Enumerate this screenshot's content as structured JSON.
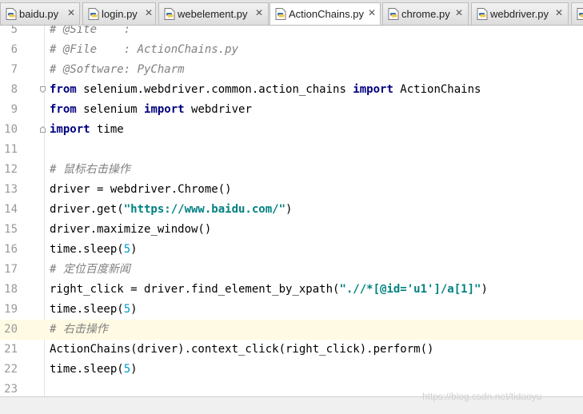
{
  "tabs": [
    {
      "label": "baidu.py"
    },
    {
      "label": "login.py"
    },
    {
      "label": "webelement.py"
    },
    {
      "label": "ActionChains.py",
      "active": true
    },
    {
      "label": "chrome.py"
    },
    {
      "label": "webdriver.py"
    }
  ],
  "editor": {
    "current_line": "20",
    "lines": [
      {
        "no": "5"
      },
      {
        "no": "6"
      },
      {
        "no": "7"
      },
      {
        "no": "8"
      },
      {
        "no": "9"
      },
      {
        "no": "10"
      },
      {
        "no": "11"
      },
      {
        "no": "12"
      },
      {
        "no": "13"
      },
      {
        "no": "14"
      },
      {
        "no": "15"
      },
      {
        "no": "16"
      },
      {
        "no": "17"
      },
      {
        "no": "18"
      },
      {
        "no": "19"
      },
      {
        "no": "20"
      },
      {
        "no": "21"
      },
      {
        "no": "22"
      },
      {
        "no": "23"
      }
    ],
    "code": {
      "l5": "# @Site    :",
      "l6": "# @File    : ActionChains.py",
      "l7": "# @Software: PyCharm",
      "l8_kw1": "from",
      "l8_mod": " selenium.webdriver.common.action_chains ",
      "l8_kw2": "import",
      "l8_name": " ActionChains",
      "l9_kw1": "from",
      "l9_mod": " selenium ",
      "l9_kw2": "import",
      "l9_name": " webdriver",
      "l10_kw": "import",
      "l10_name": " time",
      "l12": "# 鼠标右击操作",
      "l13": "driver = webdriver.Chrome()",
      "l14_a": "driver.get(",
      "l14_str": "\"https://www.baidu.com/\"",
      "l14_b": ")",
      "l15": "driver.maximize_window()",
      "l16_a": "time.sleep(",
      "l16_num": "5",
      "l16_b": ")",
      "l17": "# 定位百度新闻",
      "l18_a": "right_click = driver.find_element_by_xpath(",
      "l18_str": "\".//*[@id='u1']/a[1]\"",
      "l18_b": ")",
      "l19_a": "time.sleep(",
      "l19_num": "5",
      "l19_b": ")",
      "l20": "# 右击操作",
      "l21": "ActionChains(driver).context_click(right_click).perform()",
      "l22_a": "time.sleep(",
      "l22_num": "5",
      "l22_b": ")"
    }
  },
  "watermark": "https://blog.csdn.net/tidaoyu",
  "colors": {
    "keyword": "#000080",
    "comment": "#808080",
    "string": "#008080",
    "number": "#0099cc",
    "current_line_bg": "#fffae3"
  },
  "icons": {
    "tab_file": "python-file-icon",
    "tab_close": "close-icon"
  }
}
